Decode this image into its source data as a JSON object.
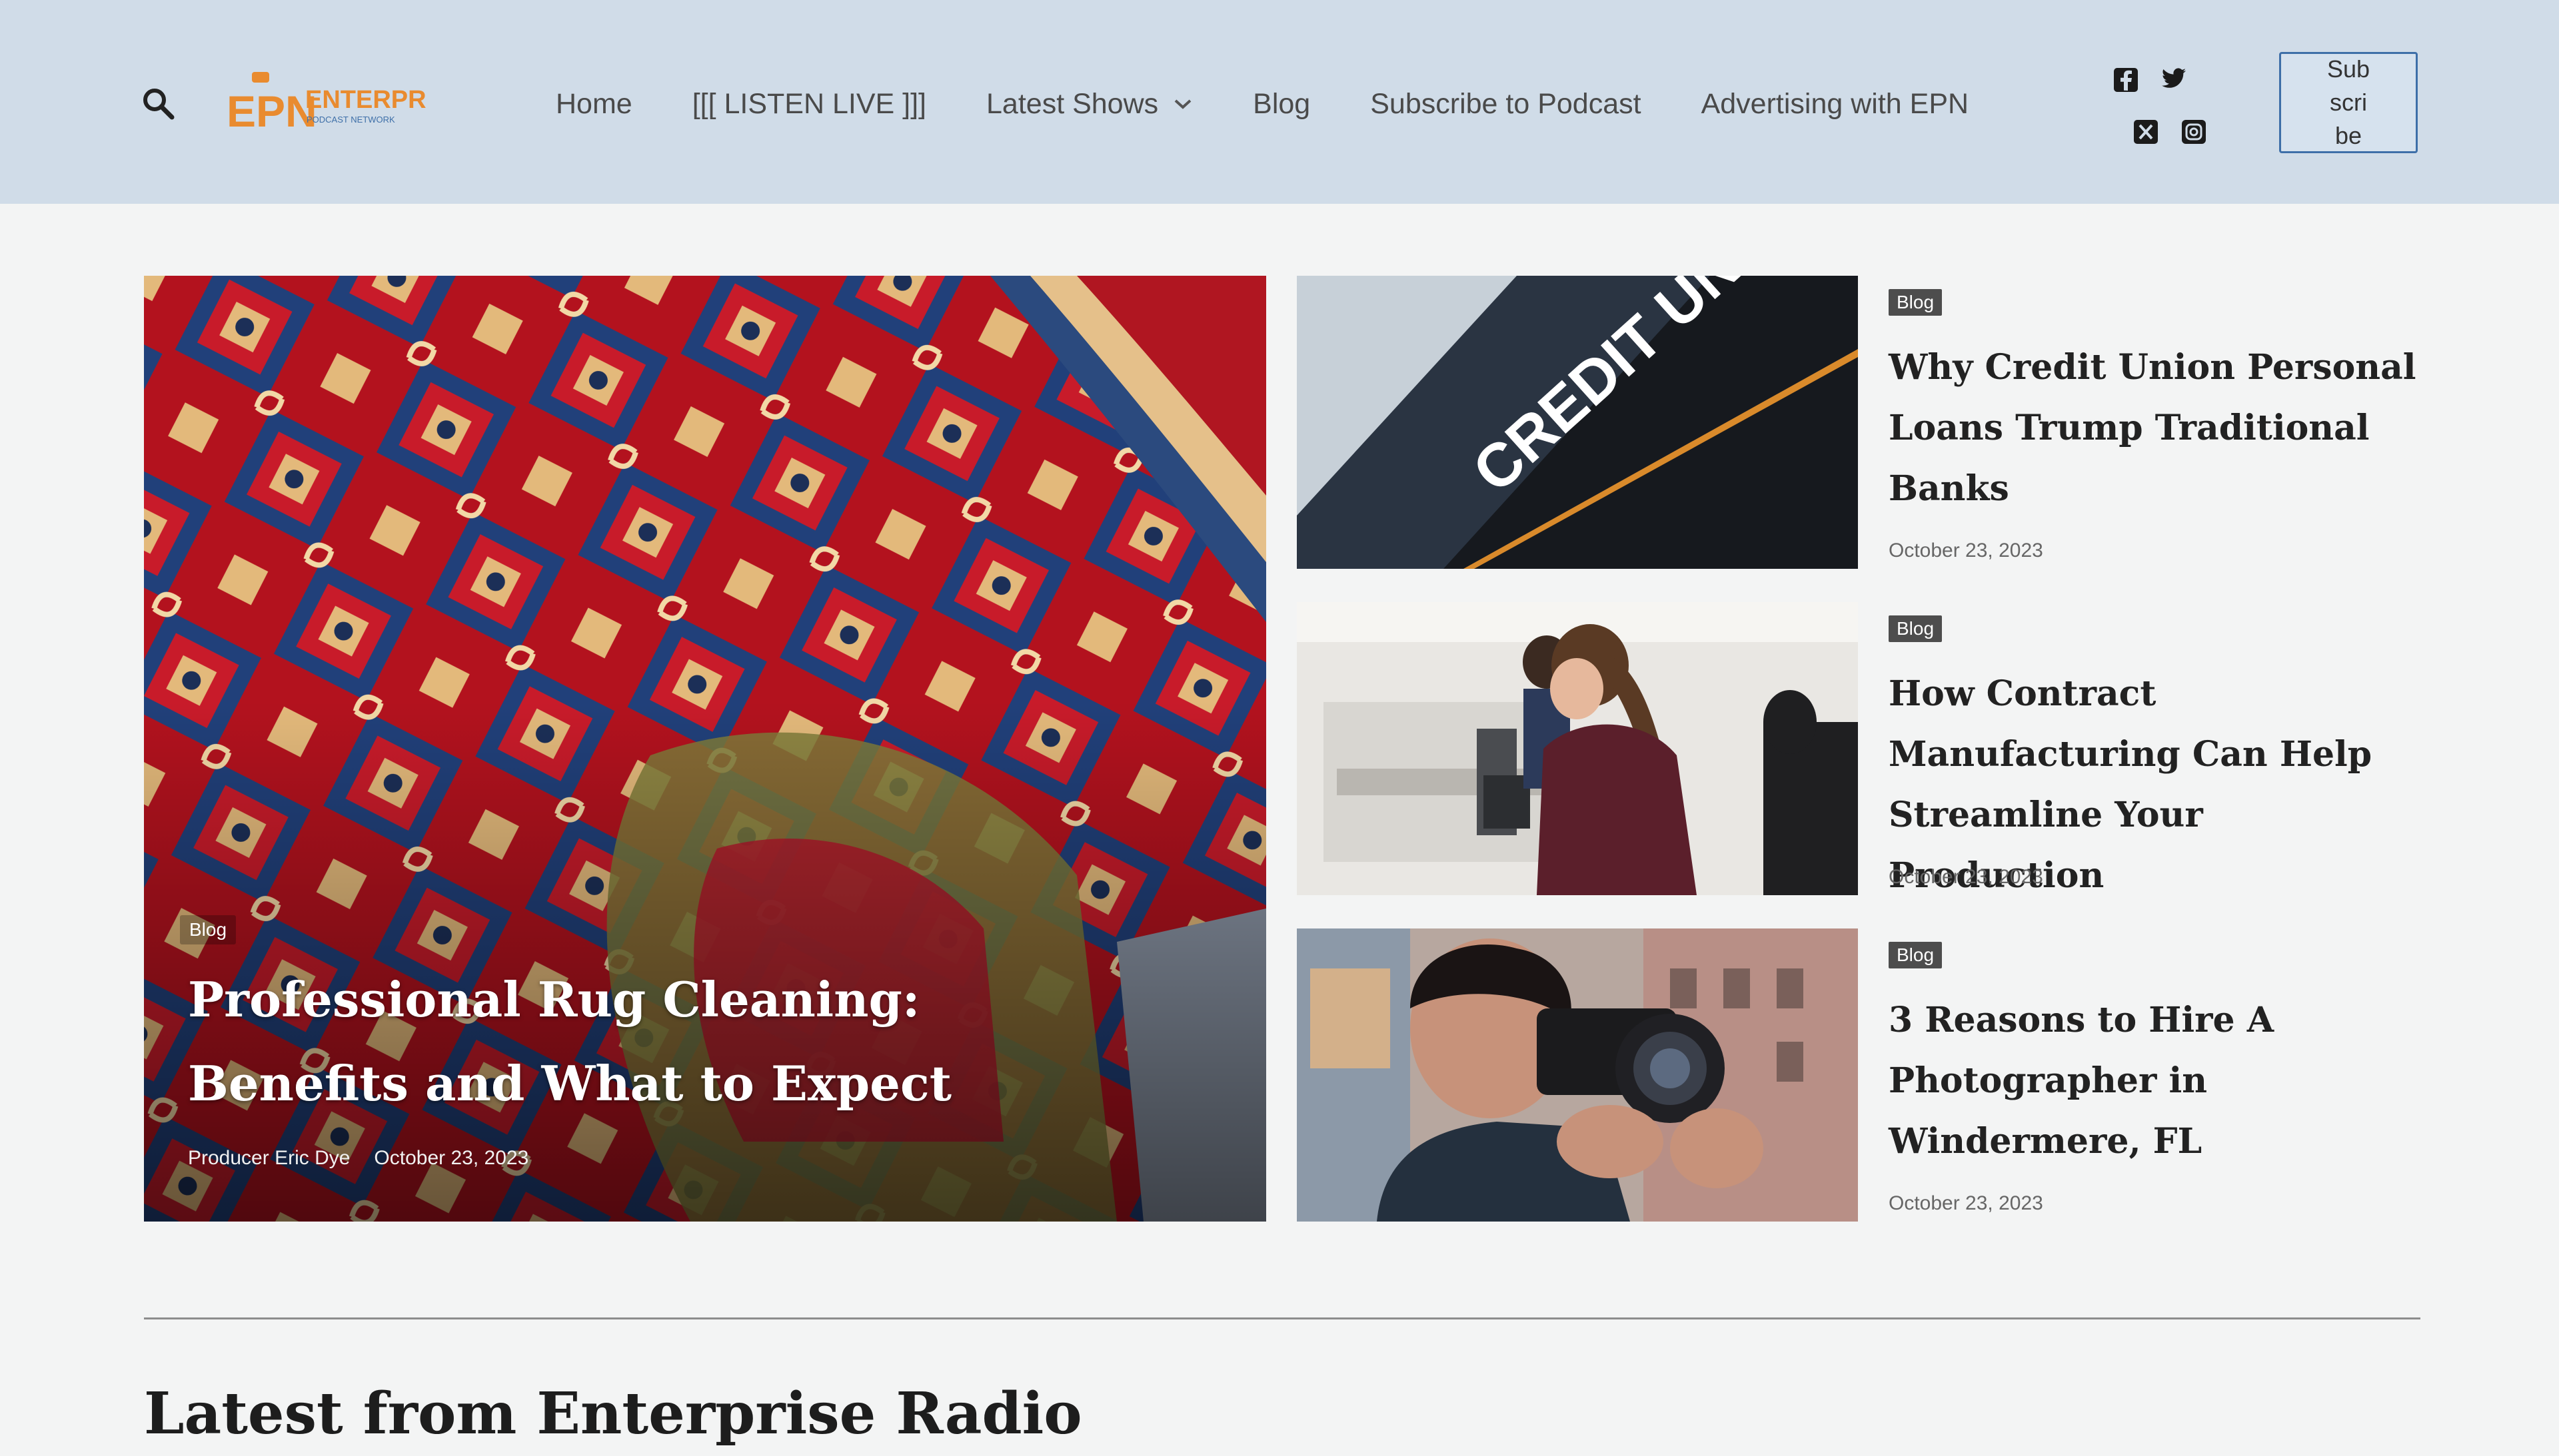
{
  "header": {
    "logo": {
      "primary": "EPN",
      "secondary": "ENTERPRISE",
      "tagline": "PODCAST NETWORK"
    },
    "nav": [
      {
        "label": "Home"
      },
      {
        "label": "[[[ LISTEN LIVE ]]]"
      },
      {
        "label": "Latest Shows"
      },
      {
        "label": "Blog"
      },
      {
        "label": "Subscribe to Podcast"
      },
      {
        "label": "Advertising with EPN"
      }
    ],
    "social_icons": [
      "facebook-icon",
      "twitter-icon",
      "x-icon",
      "instagram-icon"
    ],
    "subscribe_label": "Subscribe",
    "colors": {
      "header_bg": "#d0dce8",
      "accent": "#e98b2f",
      "logo_blue": "#3e6fa8"
    }
  },
  "hero": {
    "tag": "Blog",
    "title": "Professional Rug Cleaning: Benefits and What to Expect",
    "author": "Producer Eric Dye",
    "date": "October 23, 2023"
  },
  "posts": [
    {
      "tag": "Blog",
      "title": "Why Credit Union Personal Loans Trump Traditional Banks",
      "date": "October 23, 2023",
      "image_text": "CREDIT UNION"
    },
    {
      "tag": "Blog",
      "title": "How Contract Manufacturing Can Help Streamline Your Production",
      "date": "October 23, 2023"
    },
    {
      "tag": "Blog",
      "title": "3 Reasons to Hire A Photographer in Windermere, FL",
      "date": "October 23, 2023"
    }
  ],
  "section": {
    "title": "Latest from Enterprise Radio"
  }
}
